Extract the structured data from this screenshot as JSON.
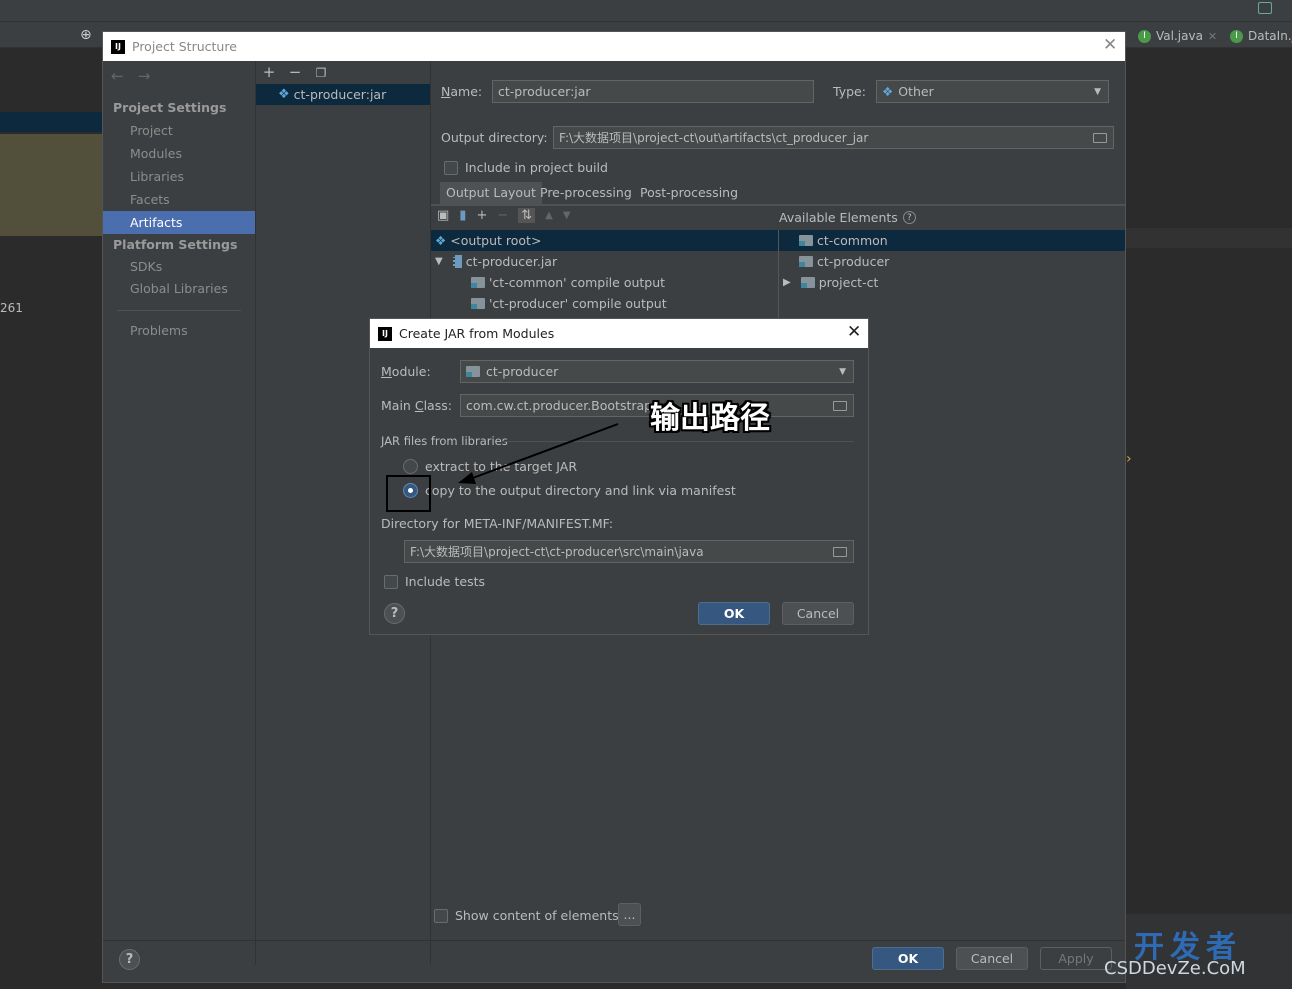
{
  "ide": {
    "left_number": "261",
    "editor_tabs": [
      {
        "label": "Val.java",
        "icon": "class-icon"
      },
      {
        "label": "DataIn.j",
        "icon": "class-icon"
      }
    ]
  },
  "project_structure": {
    "title": "Project Structure",
    "sidebar": {
      "project_settings_header": "Project Settings",
      "project_settings_items": [
        "Project",
        "Modules",
        "Libraries",
        "Facets",
        "Artifacts"
      ],
      "selected_item": "Artifacts",
      "platform_settings_header": "Platform Settings",
      "platform_settings_items": [
        "SDKs",
        "Global Libraries"
      ],
      "problems": "Problems"
    },
    "artifact_list": [
      "ct-producer:jar"
    ],
    "name_label": "Name:",
    "name_value": "ct-producer:jar",
    "type_label": "Type:",
    "type_value": "Other",
    "output_dir_label": "Output directory:",
    "output_dir_value": "F:\\大数据项目\\project-ct\\out\\artifacts\\ct_producer_jar",
    "include_in_build": "Include in project build",
    "tabs": [
      "Output Layout",
      "Pre-processing",
      "Post-processing"
    ],
    "available_elements_label": "Available Elements",
    "layout_tree": [
      "<output root>",
      "ct-producer.jar",
      "'ct-common' compile output",
      "'ct-producer' compile output"
    ],
    "available_tree": [
      "ct-common",
      "ct-producer",
      "project-ct"
    ],
    "show_content": "Show content of elements",
    "more_button": "...",
    "buttons": {
      "ok": "OK",
      "cancel": "Cancel",
      "apply": "Apply"
    }
  },
  "create_jar": {
    "title": "Create JAR from Modules",
    "module_label": "Module:",
    "module_value": "ct-producer",
    "main_class_label": "Main Class:",
    "main_class_value": "com.cw.ct.producer.Bootstrap",
    "jar_files_label": "JAR files from libraries",
    "option_extract": "extract to the target JAR",
    "option_copy": "copy to the output directory and link via manifest",
    "selected_option": "copy",
    "manifest_dir_label": "Directory for META-INF/MANIFEST.MF:",
    "manifest_dir_value": "F:\\大数据项目\\project-ct\\ct-producer\\src\\main\\java",
    "include_tests": "Include tests",
    "ok": "OK",
    "cancel": "Cancel"
  },
  "annotation": {
    "text": "输出路径"
  },
  "watermark": {
    "line1": "开发者",
    "line2": "CSDDevZe.CoM"
  },
  "colors": {
    "accent": "#4b6eaf",
    "primary_button": "#365880",
    "dialog_bg": "#3c3f41"
  }
}
